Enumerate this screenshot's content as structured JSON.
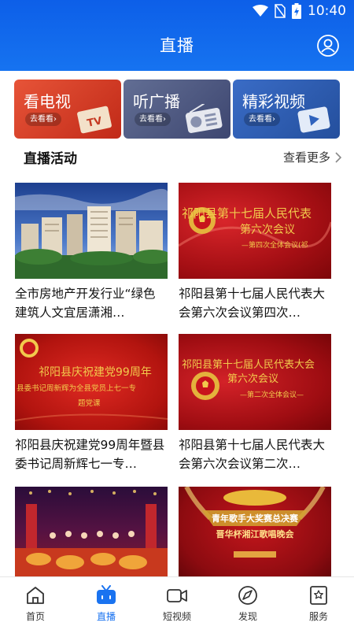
{
  "status_bar": {
    "time": "10:40"
  },
  "header": {
    "title": "直播"
  },
  "category_cards": [
    {
      "title": "看电视",
      "action": "去看看›",
      "art": "tv-icon"
    },
    {
      "title": "听广播",
      "action": "去看看›",
      "art": "radio-icon"
    },
    {
      "title": "精彩视频",
      "action": "去看看›",
      "art": "video-play-icon"
    }
  ],
  "section": {
    "title": "直播活动",
    "more": "查看更多"
  },
  "thumb_text": {
    "item2_line1": "祁阳县第十七届人民代表",
    "item2_line2": "第六次会议",
    "item2_line3": "—第四次全体会议(祁",
    "item3_line1": "祁阳县庆祝建党99周年",
    "item3_line2": "县委书记周新辉为全县党员上七一专",
    "item3_line3": "题党课",
    "item4_line1": "祁阳县第十七届人民代表大会",
    "item4_line2": "第六次会议",
    "item4_line3": "—第二次全体会议—",
    "item6_line1": "青年歌手大奖赛总决赛",
    "item6_line2": "晋华杯湘江歌唱晚会"
  },
  "feed": [
    {
      "caption": "全市房地产开发行业“绿色建筑人文宜居潇湘…"
    },
    {
      "caption": "祁阳县第十七届人民代表大会第六次会议第四次…"
    },
    {
      "caption": "祁阳县庆祝建党99周年暨县委书记周新辉七一专…"
    },
    {
      "caption": "祁阳县第十七届人民代表大会第六次会议第二次…"
    },
    {
      "caption": ""
    },
    {
      "caption": ""
    }
  ],
  "tabs": [
    {
      "label": "首页",
      "icon": "home-icon"
    },
    {
      "label": "直播",
      "icon": "live-tv-icon"
    },
    {
      "label": "短视频",
      "icon": "video-camera-icon"
    },
    {
      "label": "发现",
      "icon": "compass-icon"
    },
    {
      "label": "服务",
      "icon": "service-icon"
    }
  ],
  "colors": {
    "header": "#1168ec",
    "accent": "#1a73f0",
    "tab_inactive": "#333333"
  }
}
